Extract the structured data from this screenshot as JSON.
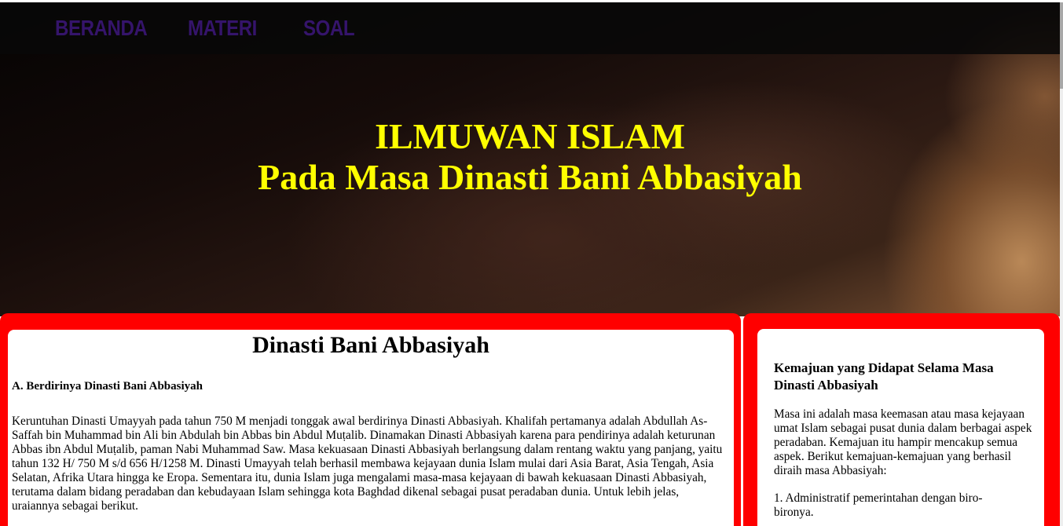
{
  "nav": {
    "items": [
      {
        "label": "BERANDA"
      },
      {
        "label": "MATERI"
      },
      {
        "label": "SOAL"
      }
    ]
  },
  "hero": {
    "title_line1": "ILMUWAN ISLAM",
    "title_line2": "Pada Masa Dinasti Bani Abbasiyah"
  },
  "main": {
    "heading": "Dinasti Bani Abbasiyah",
    "section_heading": "A. Berdirinya Dinasti Bani Abbasiyah",
    "paragraph": "Keruntuhan Dinasti Umayyah pada tahun 750 M menjadi tonggak awal berdirinya Dinasti Abbasiyah. Khalifah pertamanya adalah Abdullah As-Saffah bin Muhammad bin Ali bin Abdulah bin Abbas bin Abdul Muṭalib. Dinamakan Dinasti Abbasiyah karena para pendirinya adalah keturunan Abbas ibn Abdul Muṭalib, paman Nabi Muhammad Saw. Masa kekuasaan Dinasti Abbasiyah berlangsung dalam rentang waktu yang panjang, yaitu tahun 132 H/ 750 M s/d 656 H/1258 M. Dinasti Umayyah telah berhasil membawa kejayaan dunia Islam mulai dari Asia Barat, Asia Tengah, Asia Selatan, Afrika Utara hingga ke Eropa. Sementara itu, dunia Islam juga mengalami masa-masa kejayaan di bawah kekuasaan Dinasti Abbasiyah, terutama dalam bidang peradaban dan kebudayaan Islam sehingga kota Baghdad dikenal sebagai pusat peradaban dunia. Untuk lebih jelas, uraiannya sebagai berikut."
  },
  "sidebar": {
    "heading": "Kemajuan yang Didapat Selama Masa Dinasti Abbasiyah",
    "paragraph": "Masa ini adalah masa keemasan atau masa kejayaan umat Islam sebagai pusat dunia dalam berbagai aspek peradaban. Kemajuan itu hampir mencakup semua aspek. Berikut kemajuan-kemajuan yang berhasil diraih masa Abbasiyah:",
    "list_item_1": "1. Administratif pemerintahan dengan biro-bironya."
  },
  "colors": {
    "nav_text": "#35146b",
    "hero_title": "#ffff00",
    "panel_border": "#ff0000"
  }
}
